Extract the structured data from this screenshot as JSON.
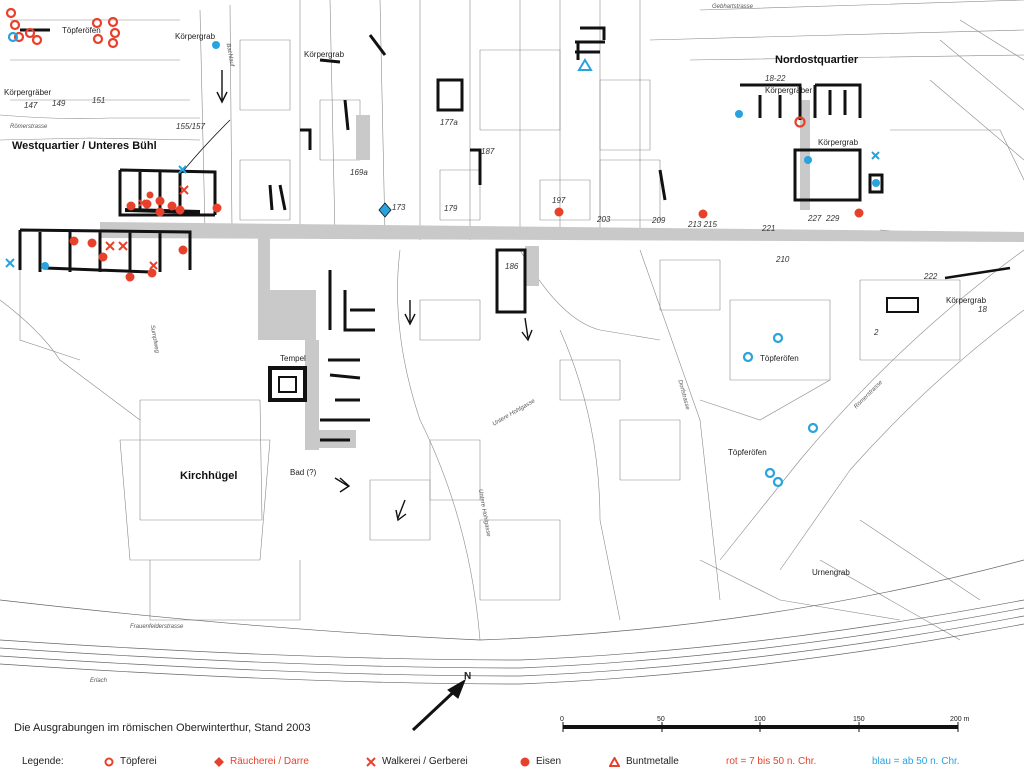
{
  "map": {
    "caption": "Die Ausgrabungen im römischen Oberwinterthur, Stand 2003",
    "north_label": "N",
    "colors": {
      "red": "#e8412b",
      "blue": "#29a3dd",
      "road": "#c9c9c9",
      "wall": "#111111",
      "line": "#8a8a8a"
    },
    "quarters": {
      "west": "Westquartier / Unteres Bühl",
      "northeast": "Nordostquartier",
      "hill": "Kirchhügel"
    },
    "labels": {
      "toepferoefen_nw": "Töpferöfen",
      "koerpergrab_1": "Körpergrab",
      "koerpergraeber_w": "Körpergräber",
      "koerpergrab_2": "Körpergrab",
      "koerpergraeber_ne": "Körpergräber",
      "koerpergrab_ne": "Körpergrab",
      "koerpergrab_e": "Körpergrab",
      "toepferoefen_se1": "Töpferöfen",
      "toepferoefen_se2": "Töpferöfen",
      "urnengrab": "Urnengrab",
      "tempel": "Tempel",
      "bad": "Bad (?)"
    },
    "parcel_numbers": {
      "n147": "147",
      "n149": "149",
      "n151": "151",
      "n155": "155/157",
      "n169": "169a",
      "n173": "173",
      "n177": "177a",
      "n179": "179",
      "n187": "187",
      "n197": "197",
      "n203": "203",
      "n209": "209",
      "n213": "213 215",
      "n221": "221",
      "n227": "227",
      "n229": "229",
      "n1822": "18-22",
      "n210": "210",
      "n186": "186",
      "n222": "222",
      "n2": "2",
      "n18": "18"
    },
    "streets": {
      "roemerstrasse_w": "Römerstrasse",
      "gebhartstrasse": "Gebhartstrasse",
      "frauenfelderstrasse": "Frauenfelderstrasse",
      "hohlgasse": "Untere Hohlgasse",
      "untere_hohlgasse": "Untere Hohlgasse",
      "dorfstrasse": "Dorfstrasse",
      "roemerstrasse_e": "Römerstrasse",
      "erlach": "Erlach",
      "bachlauf": "Bachlauf",
      "sumpfweg": "Sumpfweg"
    },
    "scale": {
      "ticks": [
        "0",
        "50",
        "100",
        "150",
        "200 m"
      ]
    }
  },
  "legend": {
    "title": "Legende:",
    "items": [
      {
        "label": "Töpferei",
        "symbol": "ring-icon"
      },
      {
        "label": "Räucherei / Darre",
        "symbol": "diamond-icon"
      },
      {
        "label": "Walkerei / Gerberei",
        "symbol": "cross-icon"
      },
      {
        "label": "Eisen",
        "symbol": "dot-icon"
      },
      {
        "label": "Buntmetalle",
        "symbol": "triangle-icon"
      }
    ],
    "period_red": "rot = 7 bis 50 n. Chr.",
    "period_blue": "blau = ab 50 n. Chr."
  }
}
